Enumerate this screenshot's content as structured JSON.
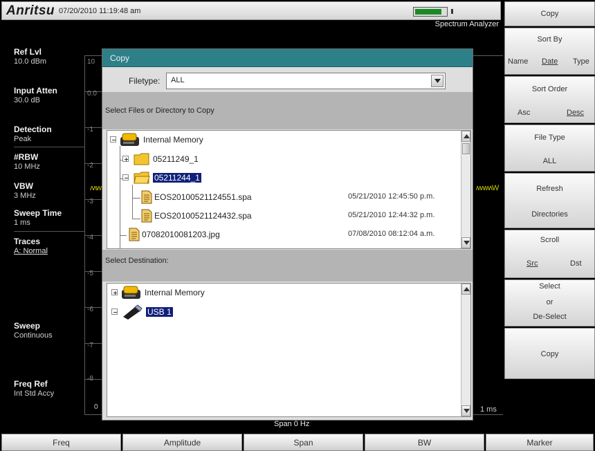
{
  "header": {
    "brand": "Anritsu",
    "datetime": "07/20/2010 11:19:48 am",
    "mode": "Spectrum Analyzer"
  },
  "params": [
    {
      "label": "Ref Lvl",
      "value": "10.0 dBm"
    },
    {
      "label": "Input Atten",
      "value": "30.0 dB"
    },
    {
      "label": "Detection",
      "value": "Peak"
    },
    {
      "label": "#RBW",
      "value": "10 MHz"
    },
    {
      "label": "VBW",
      "value": "3 MHz"
    },
    {
      "label": "Sweep Time",
      "value": "1 ms"
    },
    {
      "label": "Traces",
      "value": "A: Normal"
    },
    {
      "label": "Sweep",
      "value": "Continuous"
    },
    {
      "label": "Freq Ref",
      "value": "Int Std Accy"
    }
  ],
  "graph": {
    "y_ticks": [
      "10",
      "0.0",
      "-1",
      "-2",
      "-3",
      "-4",
      "-5",
      "-6",
      "-7",
      "-8"
    ],
    "x_start": "0",
    "x_end": "1 ms",
    "span": "Span 0 Hz",
    "trace_left": "ʌʌw",
    "trace_right": "ʍʌʍʌW"
  },
  "softkeys": {
    "title": "Copy",
    "sort_by": {
      "label": "Sort By",
      "options": [
        "Name",
        "Date",
        "Type"
      ],
      "selected": "Date"
    },
    "sort_order": {
      "label": "Sort Order",
      "options": [
        "Asc",
        "Desc"
      ],
      "selected": "Desc"
    },
    "file_type": {
      "label": "File Type",
      "value": "ALL"
    },
    "refresh": {
      "line1": "Refresh",
      "line2": "Directories"
    },
    "scroll": {
      "label": "Scroll",
      "options": [
        "Src",
        "Dst"
      ],
      "selected": "Src"
    },
    "select": {
      "line1": "Select",
      "line2": "or",
      "line3": "De-Select"
    },
    "copy": "Copy"
  },
  "bottom_menu": [
    "Freq",
    "Amplitude",
    "Span",
    "BW",
    "Marker"
  ],
  "dialog": {
    "title": "Copy",
    "filetype_label": "Filetype:",
    "filetype_value": "ALL",
    "source_label": "Select Files or Directory to Copy",
    "dest_label": "Select Destination:",
    "source_tree": [
      {
        "name": "Internal Memory",
        "date": ""
      },
      {
        "name": "05211249_1",
        "date": ""
      },
      {
        "name": "05211244_1",
        "date": ""
      },
      {
        "name": "EOS20100521124551.spa",
        "date": "05/21/2010 12:45:50 p.m."
      },
      {
        "name": "EOS20100521124432.spa",
        "date": "05/21/2010 12:44:32 p.m."
      },
      {
        "name": "07082010081203.jpg",
        "date": "07/08/2010 08:12:04 a.m."
      }
    ],
    "dest_tree": [
      {
        "name": "Internal Memory"
      },
      {
        "name": "USB 1"
      }
    ]
  },
  "colors": {
    "dialog_title": "#2d8088",
    "selection": "#10207a",
    "trace": "#c8c800",
    "battery": "#1b8a25"
  }
}
